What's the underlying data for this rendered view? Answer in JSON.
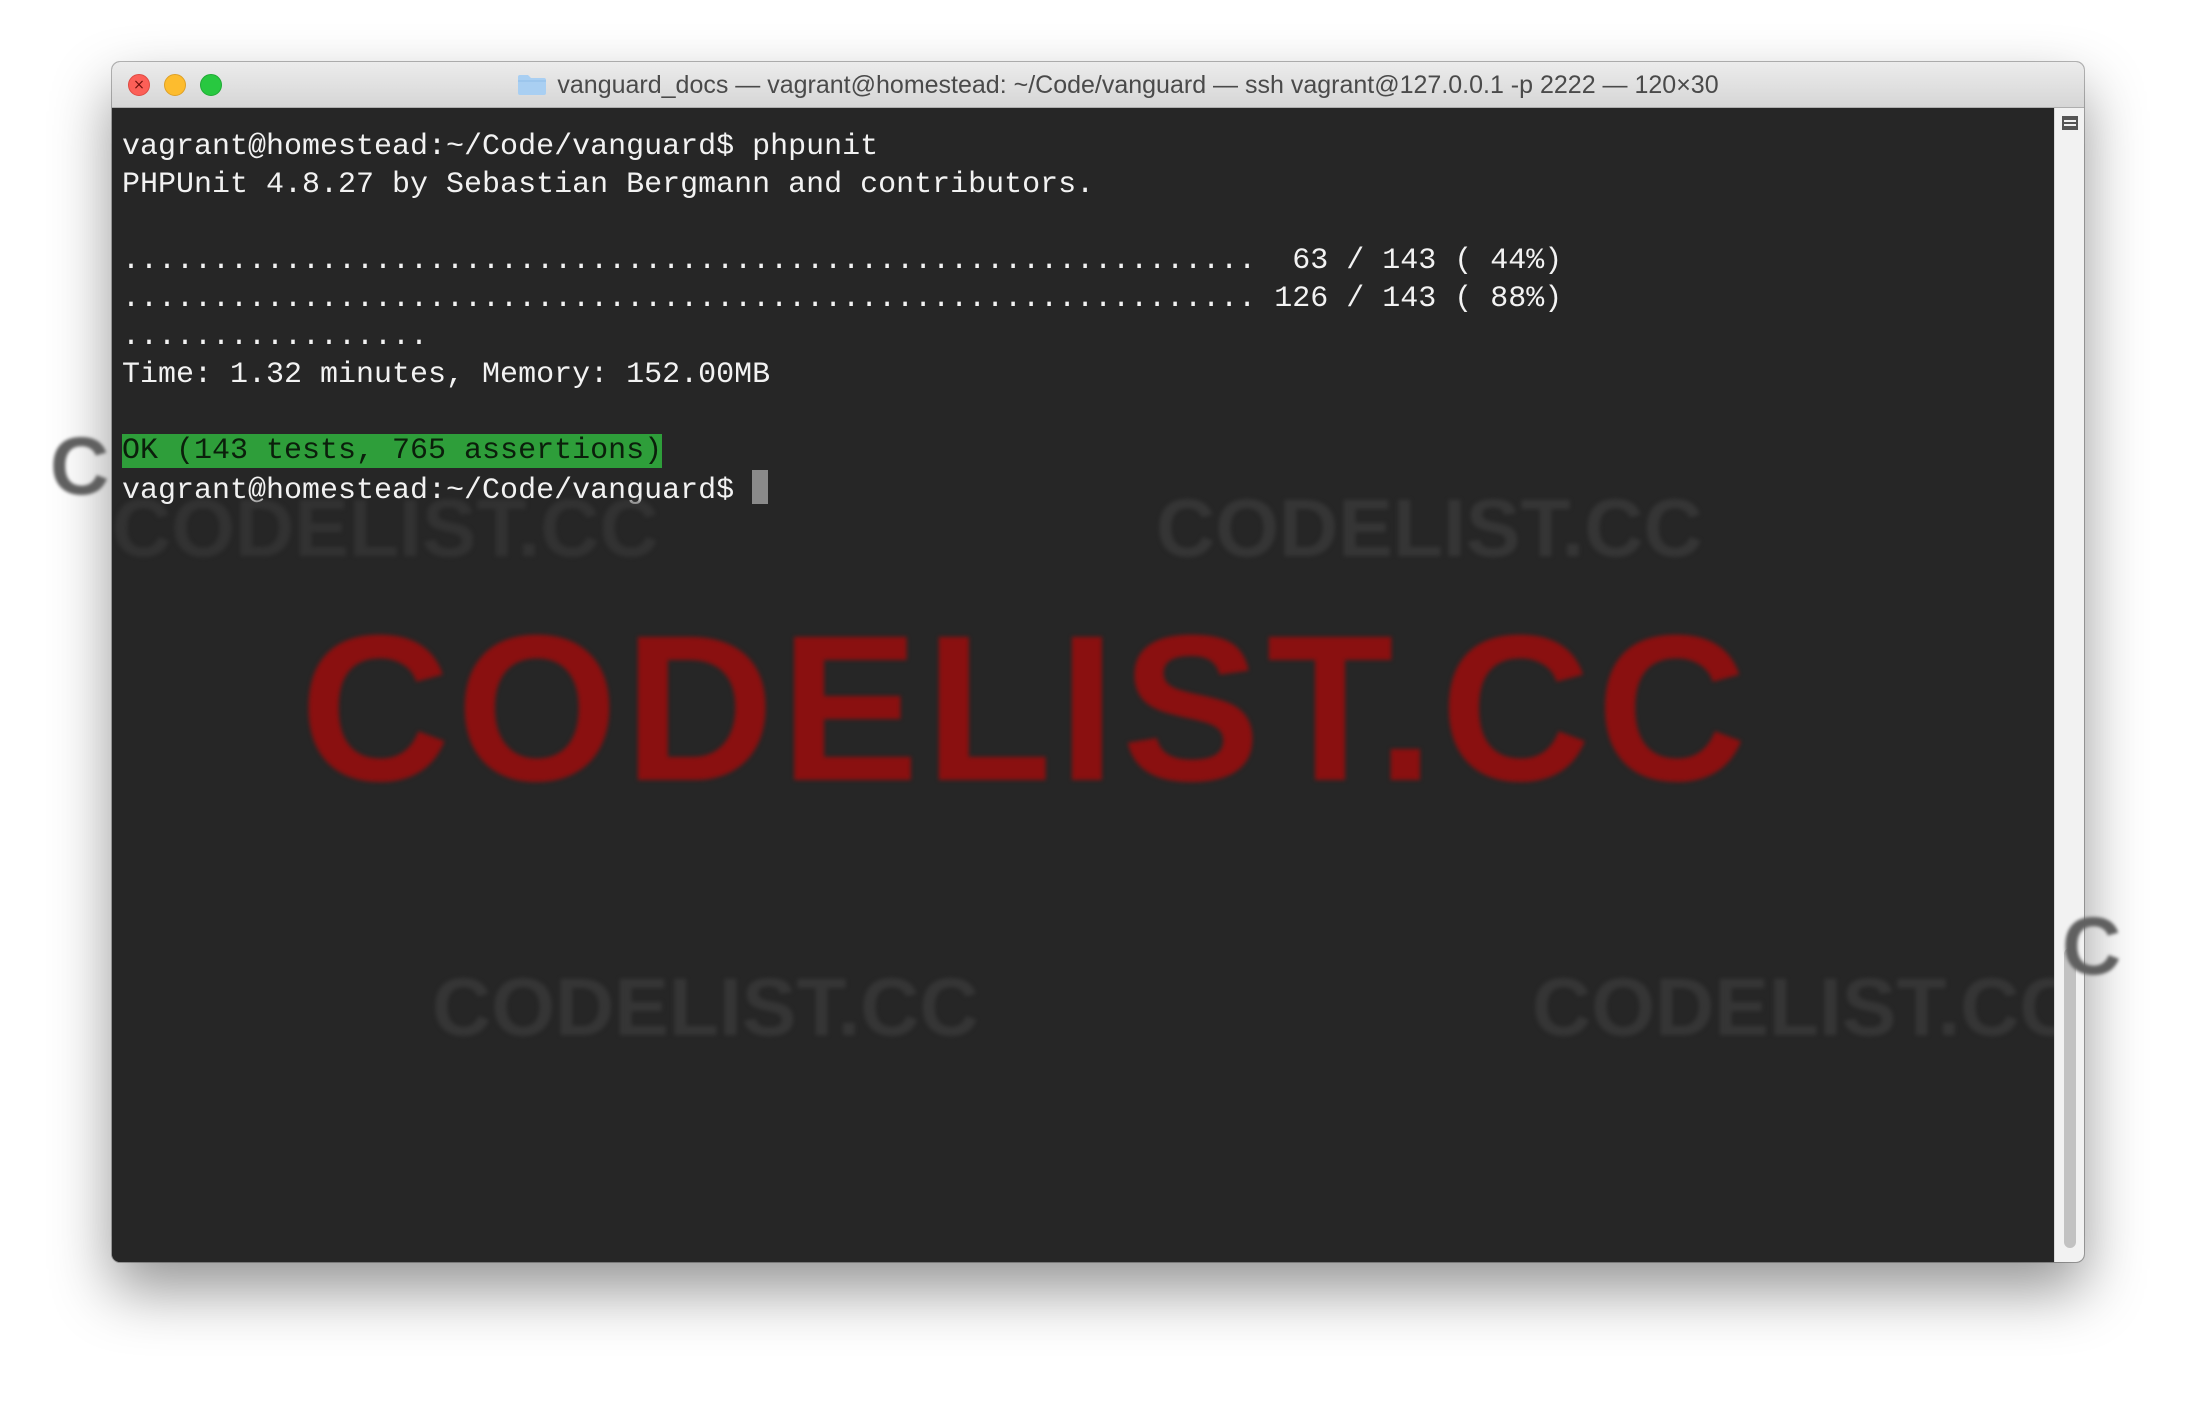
{
  "window": {
    "title": "vanguard_docs — vagrant@homestead: ~/Code/vanguard — ssh vagrant@127.0.0.1 -p 2222 — 120×30",
    "icons": {
      "close": "close-icon",
      "minimize": "minimize-icon",
      "maximize": "maximize-icon",
      "folder": "folder-icon",
      "split": "split-pane-icon"
    },
    "colors": {
      "background": "#262626",
      "text": "#f2f2f2",
      "ok_highlight": "#2e9e3a",
      "watermark": "#8a1010"
    }
  },
  "terminal": {
    "lines": [
      "vagrant@homestead:~/Code/vanguard$ phpunit",
      "PHPUnit 4.8.27 by Sebastian Bergmann and contributors.",
      "",
      "...............................................................  63 / 143 ( 44%)",
      "............................................................... 126 / 143 ( 88%)",
      ".................",
      "",
      "Time: 1.32 minutes, Memory: 152.00MB",
      "",
      "OK (143 tests, 765 assertions)",
      "vagrant@homestead:~/Code/vanguard$ "
    ]
  },
  "watermarks": {
    "main": "CODELIST.CC",
    "top_left": "CODELIST.CC",
    "top_right": "CODELIST.CC",
    "bottom_left": "CODELIST.CC",
    "bottom_right": "CODELIST.CC",
    "edge_letter": "C"
  }
}
